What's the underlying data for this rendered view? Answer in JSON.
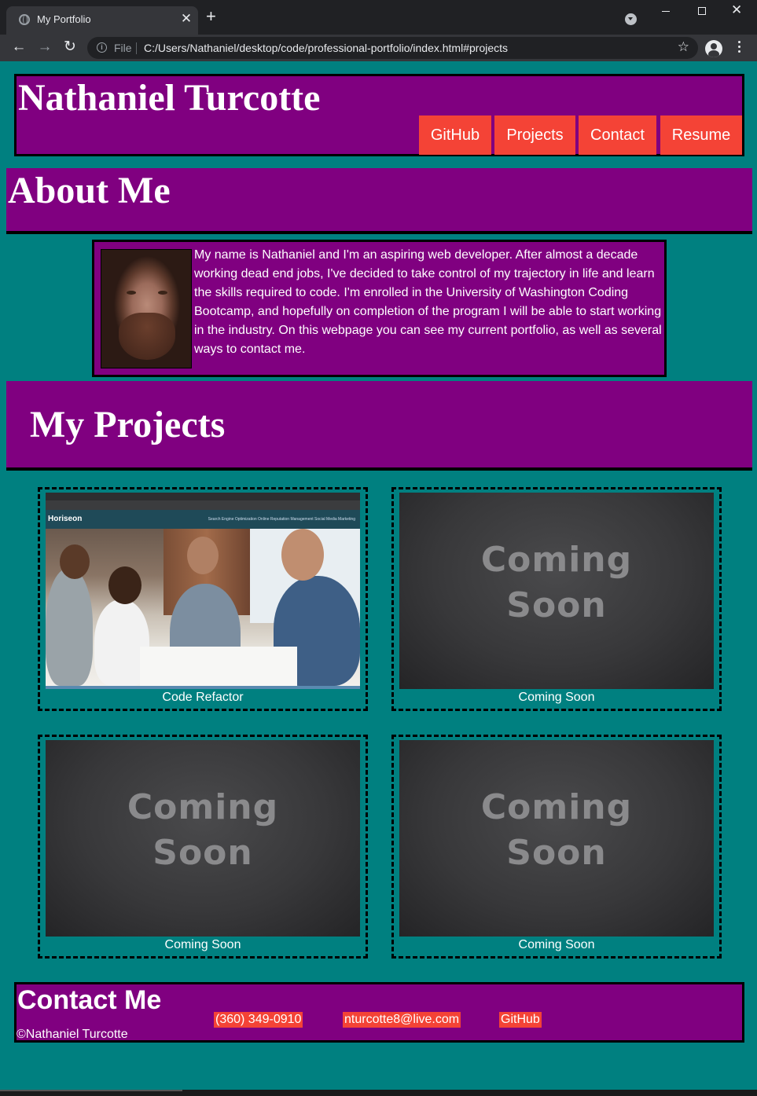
{
  "browser": {
    "tab_title": "My Portfolio",
    "new_tab": "+",
    "tab_close": "✕",
    "address": {
      "scheme_label": "File",
      "url": "C:/Users/Nathaniel/desktop/code/professional-portfolio/index.html#projects"
    }
  },
  "header": {
    "name": "Nathaniel Turcotte",
    "nav": [
      "GitHub",
      "Projects",
      "Contact",
      "Resume"
    ]
  },
  "about": {
    "heading": "About Me",
    "text": "My name is Nathaniel and I'm an aspiring web developer. After almost a decade working dead end jobs, I've decided to take control of my trajectory in life and learn the skills required to code. I'm enrolled in the University of Washington Coding Bootcamp, and hopefully on completion of the program I will be able to start working in the industry. On this webpage you can see my current portfolio, as well as several ways to contact me."
  },
  "projects": {
    "heading": "My Projects",
    "placeholder_image_text": [
      "Coming",
      "Soon"
    ],
    "screenshot_brand": "Horiseon",
    "screenshot_nav": "Search Engine Optimization     Online Reputation Management     Social Media Marketing",
    "items": [
      {
        "caption": "Code Refactor"
      },
      {
        "caption": "Coming Soon"
      },
      {
        "caption": "Coming Soon"
      },
      {
        "caption": "Coming Soon"
      }
    ]
  },
  "footer": {
    "heading": "Contact Me",
    "copyright": "©Nathaniel Turcotte",
    "links": [
      "(360) 349-0910",
      "nturcotte8@live.com",
      "GitHub"
    ]
  },
  "colors": {
    "page_background": "#008080",
    "panel": "#800080",
    "accent_button": "#f44336",
    "border": "#000000"
  }
}
